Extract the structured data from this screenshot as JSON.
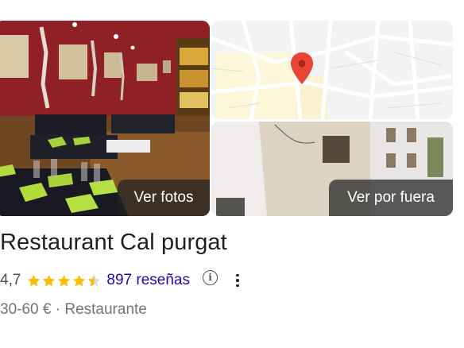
{
  "photos": {
    "main_button_label": "Ver fotos",
    "street_button_label": "Ver por fuera"
  },
  "map": {
    "pin_color": "#ea4335"
  },
  "place": {
    "name": "Restaurant Cal purgat",
    "rating": "4,7",
    "stars_value": 4.5,
    "reviews_label": "897 reseñas",
    "info_glyph": "i",
    "price_range": "30-60 €",
    "separator": "·",
    "category": "Restaurante"
  },
  "colors": {
    "star": "#fbbc04",
    "star_empty": "#dadce0",
    "link": "#1a0dab",
    "title": "#202124",
    "secondary": "#70757a"
  }
}
